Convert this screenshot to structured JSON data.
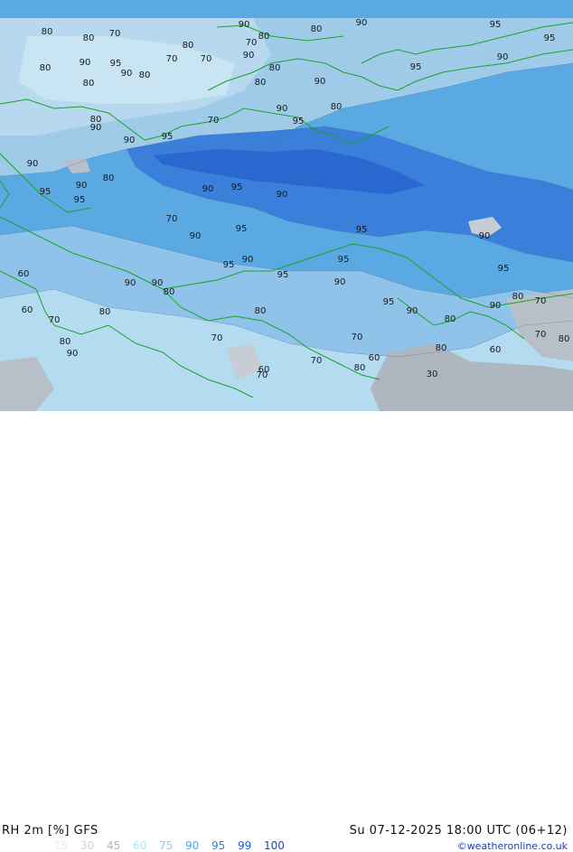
{
  "title_left": "RH 2m [%] GFS",
  "title_right": "Su 07-12-2025 18:00 UTC (06+12)",
  "credit": "©weatheronline.co.uk",
  "scale": [
    {
      "v": "15",
      "c": "#e6ecf3"
    },
    {
      "v": "30",
      "c": "#c8d4e2"
    },
    {
      "v": "45",
      "c": "#a9b7c8"
    },
    {
      "v": "60",
      "c": "#a8e4f0"
    },
    {
      "v": "75",
      "c": "#7fd3ec"
    },
    {
      "v": "90",
      "c": "#52a6e3"
    },
    {
      "v": "95",
      "c": "#2f7fd6"
    },
    {
      "v": "99",
      "c": "#1f5fcf"
    },
    {
      "v": "100",
      "c": "#1b46c2"
    }
  ],
  "contour_labels": [
    {
      "t": "80"
    },
    {
      "t": "80"
    },
    {
      "t": "70"
    },
    {
      "t": "90"
    },
    {
      "t": "80"
    },
    {
      "t": "90"
    },
    {
      "t": "95"
    },
    {
      "t": "95"
    },
    {
      "t": "80"
    },
    {
      "t": "70"
    },
    {
      "t": "80"
    },
    {
      "t": "95"
    },
    {
      "t": "90"
    },
    {
      "t": "80"
    },
    {
      "t": "90"
    },
    {
      "t": "95"
    },
    {
      "t": "70"
    },
    {
      "t": "80"
    },
    {
      "t": "70"
    },
    {
      "t": "90"
    },
    {
      "t": "80"
    },
    {
      "t": "90"
    },
    {
      "t": "80"
    },
    {
      "t": "80"
    },
    {
      "t": "90"
    },
    {
      "t": "80"
    },
    {
      "t": "90"
    },
    {
      "t": "95"
    },
    {
      "t": "95"
    },
    {
      "t": "90"
    },
    {
      "t": "70"
    },
    {
      "t": "90"
    },
    {
      "t": "80"
    },
    {
      "t": "95"
    },
    {
      "t": "90"
    },
    {
      "t": "95"
    },
    {
      "t": "80"
    },
    {
      "t": "90"
    },
    {
      "t": "90"
    },
    {
      "t": "70"
    },
    {
      "t": "90"
    },
    {
      "t": "95"
    },
    {
      "t": "95"
    },
    {
      "t": "90"
    },
    {
      "t": "95"
    },
    {
      "t": "90"
    },
    {
      "t": "95"
    },
    {
      "t": "60"
    },
    {
      "t": "90"
    },
    {
      "t": "80"
    },
    {
      "t": "90"
    },
    {
      "t": "95"
    },
    {
      "t": "95"
    },
    {
      "t": "90"
    },
    {
      "t": "95"
    },
    {
      "t": "80"
    },
    {
      "t": "70"
    },
    {
      "t": "90"
    },
    {
      "t": "80"
    },
    {
      "t": "80"
    },
    {
      "t": "90"
    },
    {
      "t": "70"
    },
    {
      "t": "60"
    },
    {
      "t": "80"
    },
    {
      "t": "90"
    },
    {
      "t": "70"
    },
    {
      "t": "60"
    },
    {
      "t": "70"
    },
    {
      "t": "80"
    },
    {
      "t": "70"
    },
    {
      "t": "95"
    },
    {
      "t": "90"
    },
    {
      "t": "80"
    },
    {
      "t": "60"
    },
    {
      "t": "70"
    },
    {
      "t": "30"
    },
    {
      "t": "80"
    },
    {
      "t": "80"
    },
    {
      "t": "60"
    },
    {
      "t": "70"
    }
  ]
}
